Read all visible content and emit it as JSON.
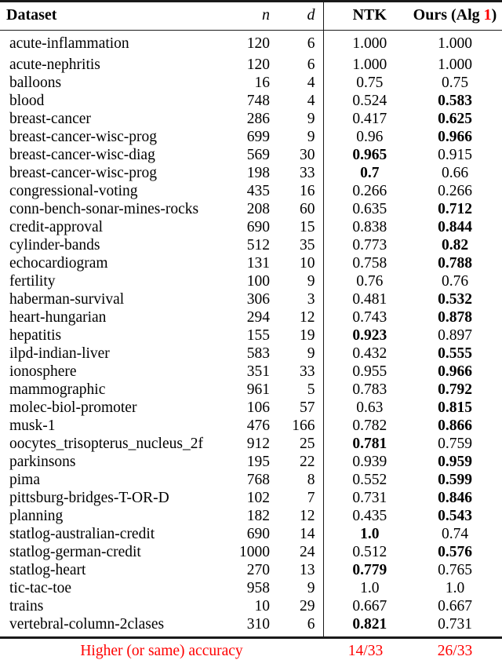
{
  "table": {
    "columns": [
      {
        "key": "dataset",
        "label": "Dataset",
        "align": "left",
        "style": "bold"
      },
      {
        "key": "n",
        "label": "n",
        "align": "right",
        "style": "italic"
      },
      {
        "key": "d",
        "label": "d",
        "align": "right",
        "style": "italic"
      },
      {
        "key": "ntk",
        "label": "NTK",
        "align": "center",
        "style": "bold"
      },
      {
        "key": "ours",
        "label": "Ours (Alg 1)",
        "align": "center",
        "style": "bold"
      }
    ],
    "header": {
      "dataset": "Dataset",
      "n": "n",
      "d": "d",
      "ntk": "NTK",
      "ours_prefix": "Ours (Alg ",
      "ours_alg_number": "1",
      "ours_suffix": ")"
    },
    "rows": [
      {
        "dataset": "acute-inflammation",
        "n": "120",
        "d": "6",
        "ntk": "1.000",
        "ntk_bold": false,
        "ours": "1.000",
        "ours_bold": false
      },
      {
        "dataset": "acute-nephritis",
        "n": "120",
        "d": "6",
        "ntk": "1.000",
        "ntk_bold": false,
        "ours": "1.000",
        "ours_bold": false
      },
      {
        "dataset": "balloons",
        "n": "16",
        "d": "4",
        "ntk": "0.75",
        "ntk_bold": false,
        "ours": "0.75",
        "ours_bold": false
      },
      {
        "dataset": "blood",
        "n": "748",
        "d": "4",
        "ntk": "0.524",
        "ntk_bold": false,
        "ours": "0.583",
        "ours_bold": true
      },
      {
        "dataset": "breast-cancer",
        "n": "286",
        "d": "9",
        "ntk": "0.417",
        "ntk_bold": false,
        "ours": "0.625",
        "ours_bold": true
      },
      {
        "dataset": "breast-cancer-wisc-prog",
        "n": "699",
        "d": "9",
        "ntk": "0.96",
        "ntk_bold": false,
        "ours": "0.966",
        "ours_bold": true
      },
      {
        "dataset": "breast-cancer-wisc-diag",
        "n": "569",
        "d": "30",
        "ntk": "0.965",
        "ntk_bold": true,
        "ours": "0.915",
        "ours_bold": false
      },
      {
        "dataset": "breast-cancer-wisc-prog",
        "n": "198",
        "d": "33",
        "ntk": "0.7",
        "ntk_bold": true,
        "ours": "0.66",
        "ours_bold": false
      },
      {
        "dataset": "congressional-voting",
        "n": "435",
        "d": "16",
        "ntk": "0.266",
        "ntk_bold": false,
        "ours": "0.266",
        "ours_bold": false
      },
      {
        "dataset": "conn-bench-sonar-mines-rocks",
        "n": "208",
        "d": "60",
        "ntk": "0.635",
        "ntk_bold": false,
        "ours": "0.712",
        "ours_bold": true
      },
      {
        "dataset": "credit-approval",
        "n": "690",
        "d": "15",
        "ntk": "0.838",
        "ntk_bold": false,
        "ours": "0.844",
        "ours_bold": true
      },
      {
        "dataset": "cylinder-bands",
        "n": "512",
        "d": "35",
        "ntk": "0.773",
        "ntk_bold": false,
        "ours": "0.82",
        "ours_bold": true
      },
      {
        "dataset": "echocardiogram",
        "n": "131",
        "d": "10",
        "ntk": "0.758",
        "ntk_bold": false,
        "ours": "0.788",
        "ours_bold": true
      },
      {
        "dataset": "fertility",
        "n": "100",
        "d": "9",
        "ntk": "0.76",
        "ntk_bold": false,
        "ours": "0.76",
        "ours_bold": false
      },
      {
        "dataset": "haberman-survival",
        "n": "306",
        "d": "3",
        "ntk": "0.481",
        "ntk_bold": false,
        "ours": "0.532",
        "ours_bold": true
      },
      {
        "dataset": "heart-hungarian",
        "n": "294",
        "d": "12",
        "ntk": "0.743",
        "ntk_bold": false,
        "ours": "0.878",
        "ours_bold": true
      },
      {
        "dataset": "hepatitis",
        "n": "155",
        "d": "19",
        "ntk": "0.923",
        "ntk_bold": true,
        "ours": "0.897",
        "ours_bold": false
      },
      {
        "dataset": "ilpd-indian-liver",
        "n": "583",
        "d": "9",
        "ntk": "0.432",
        "ntk_bold": false,
        "ours": "0.555",
        "ours_bold": true
      },
      {
        "dataset": "ionosphere",
        "n": "351",
        "d": "33",
        "ntk": "0.955",
        "ntk_bold": false,
        "ours": "0.966",
        "ours_bold": true
      },
      {
        "dataset": "mammographic",
        "n": "961",
        "d": "5",
        "ntk": "0.783",
        "ntk_bold": false,
        "ours": "0.792",
        "ours_bold": true
      },
      {
        "dataset": "molec-biol-promoter",
        "n": "106",
        "d": "57",
        "ntk": "0.63",
        "ntk_bold": false,
        "ours": "0.815",
        "ours_bold": true
      },
      {
        "dataset": "musk-1",
        "n": "476",
        "d": "166",
        "ntk": "0.782",
        "ntk_bold": false,
        "ours": "0.866",
        "ours_bold": true
      },
      {
        "dataset": "oocytes_trisopterus_nucleus_2f",
        "n": "912",
        "d": "25",
        "ntk": "0.781",
        "ntk_bold": true,
        "ours": "0.759",
        "ours_bold": false
      },
      {
        "dataset": "parkinsons",
        "n": "195",
        "d": "22",
        "ntk": "0.939",
        "ntk_bold": false,
        "ours": "0.959",
        "ours_bold": true
      },
      {
        "dataset": "pima",
        "n": "768",
        "d": "8",
        "ntk": "0.552",
        "ntk_bold": false,
        "ours": "0.599",
        "ours_bold": true
      },
      {
        "dataset": "pittsburg-bridges-T-OR-D",
        "n": "102",
        "d": "7",
        "ntk": "0.731",
        "ntk_bold": false,
        "ours": "0.846",
        "ours_bold": true
      },
      {
        "dataset": "planning",
        "n": "182",
        "d": "12",
        "ntk": "0.435",
        "ntk_bold": false,
        "ours": "0.543",
        "ours_bold": true
      },
      {
        "dataset": "statlog-australian-credit",
        "n": "690",
        "d": "14",
        "ntk": "1.0",
        "ntk_bold": true,
        "ours": "0.74",
        "ours_bold": false
      },
      {
        "dataset": "statlog-german-credit",
        "n": "1000",
        "d": "24",
        "ntk": "0.512",
        "ntk_bold": false,
        "ours": "0.576",
        "ours_bold": true
      },
      {
        "dataset": "statlog-heart",
        "n": "270",
        "d": "13",
        "ntk": "0.779",
        "ntk_bold": true,
        "ours": "0.765",
        "ours_bold": false
      },
      {
        "dataset": "tic-tac-toe",
        "n": "958",
        "d": "9",
        "ntk": "1.0",
        "ntk_bold": false,
        "ours": "1.0",
        "ours_bold": false
      },
      {
        "dataset": "trains",
        "n": "10",
        "d": "29",
        "ntk": "0.667",
        "ntk_bold": false,
        "ours": "0.667",
        "ours_bold": false
      },
      {
        "dataset": "vertebral-column-2clases",
        "n": "310",
        "d": "6",
        "ntk": "0.821",
        "ntk_bold": true,
        "ours": "0.731",
        "ours_bold": false
      }
    ],
    "footer": {
      "label": "Higher (or same) accuracy",
      "ntk": "14/33",
      "ours": "26/33"
    },
    "colors": {
      "text": "#000000",
      "highlight": "#ff0000",
      "rule": "#1a1a1a",
      "background": "#ffffff"
    }
  }
}
